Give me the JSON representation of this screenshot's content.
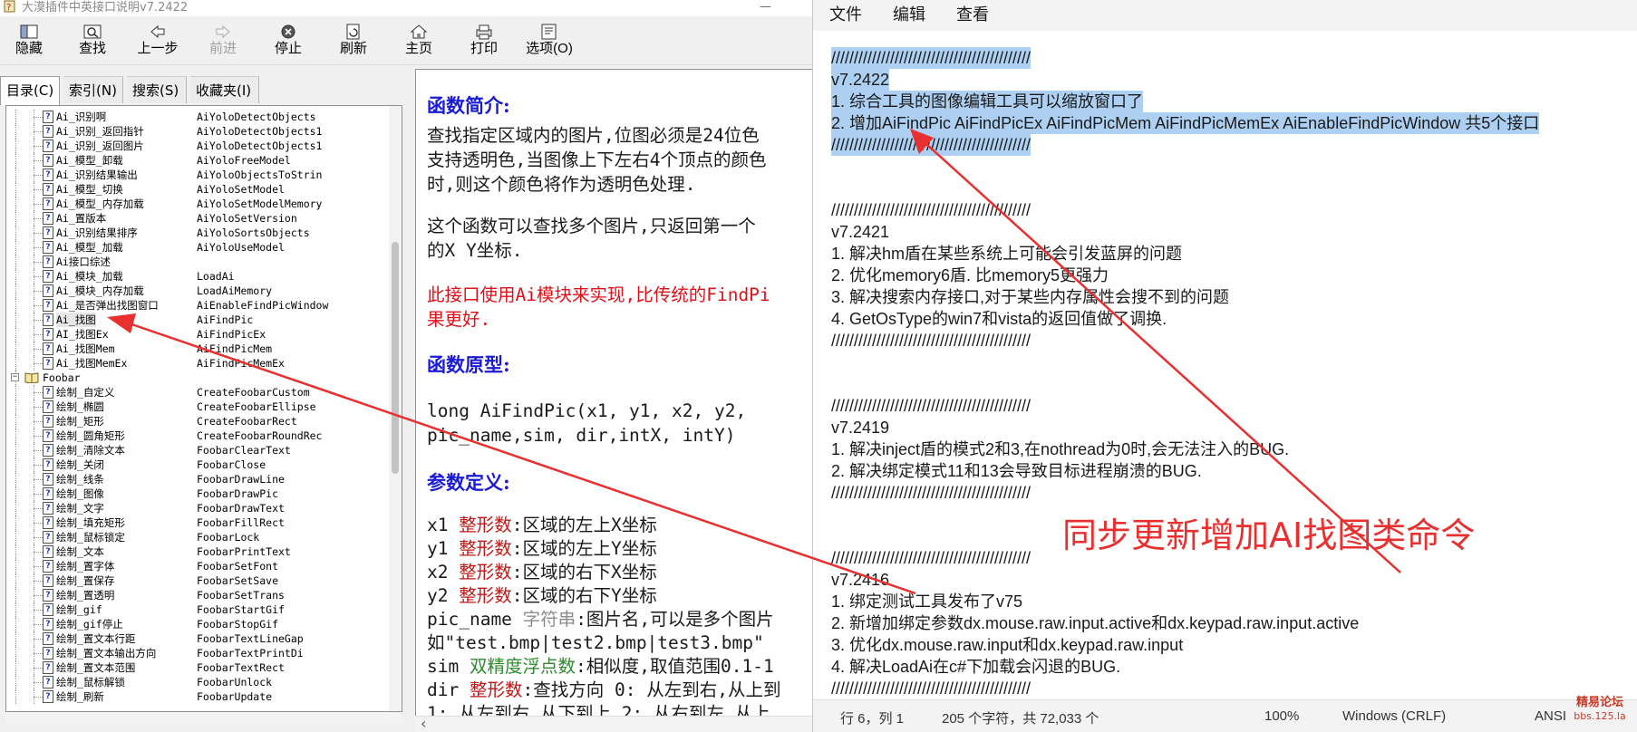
{
  "chm": {
    "title": "大漠插件中英接口说明v7.2422",
    "toolbar": [
      {
        "label": "隐藏",
        "icon": "hide-icon"
      },
      {
        "label": "查找",
        "icon": "find-icon"
      },
      {
        "label": "上一步",
        "icon": "back-arrow-icon"
      },
      {
        "label": "前进",
        "icon": "forward-arrow-icon",
        "disabled": true
      },
      {
        "label": "停止",
        "icon": "stop-icon"
      },
      {
        "label": "刷新",
        "icon": "refresh-icon"
      },
      {
        "label": "主页",
        "icon": "home-icon"
      },
      {
        "label": "打印",
        "icon": "print-icon"
      },
      {
        "label": "选项(O)",
        "icon": "options-icon"
      }
    ],
    "nav_tabs": [
      "目录(C)",
      "索引(N)",
      "搜索(S)",
      "收藏夹(I)"
    ],
    "tree": [
      {
        "name": "Ai_识别啊",
        "api": "AiYoloDetectObjects",
        "indent": 2,
        "icon": "doc"
      },
      {
        "name": "Ai_识别_返回指针",
        "api": "AiYoloDetectObjects1",
        "indent": 2,
        "icon": "doc"
      },
      {
        "name": "Ai_识别_返回图片",
        "api": "AiYoloDetectObjects1",
        "indent": 2,
        "icon": "doc"
      },
      {
        "name": "Ai_模型_卸载",
        "api": "AiYoloFreeModel",
        "indent": 2,
        "icon": "doc"
      },
      {
        "name": "Ai_识别结果输出",
        "api": "AiYoloObjectsToStrin",
        "indent": 2,
        "icon": "doc"
      },
      {
        "name": "Ai_模型_切换",
        "api": "AiYoloSetModel",
        "indent": 2,
        "icon": "doc"
      },
      {
        "name": "Ai_模型_内存加载",
        "api": "AiYoloSetModelMemory",
        "indent": 2,
        "icon": "doc"
      },
      {
        "name": "Ai_置版本",
        "api": "AiYoloSetVersion",
        "indent": 2,
        "icon": "doc"
      },
      {
        "name": "Ai_识别结果排序",
        "api": "AiYoloSortsObjects",
        "indent": 2,
        "icon": "doc"
      },
      {
        "name": "Ai_模型_加载",
        "api": "AiYoloUseModel",
        "indent": 2,
        "icon": "doc"
      },
      {
        "name": "Ai接口综述",
        "api": "",
        "indent": 2,
        "icon": "doc"
      },
      {
        "name": "Ai_模块_加载",
        "api": "LoadAi",
        "indent": 2,
        "icon": "doc"
      },
      {
        "name": "Ai_模块_内存加载",
        "api": "LoadAiMemory",
        "indent": 2,
        "icon": "doc"
      },
      {
        "name": "Ai_是否弹出找图窗口",
        "api": "AiEnableFindPicWindow",
        "indent": 2,
        "icon": "doc"
      },
      {
        "name": "Ai_找图",
        "api": "AiFindPic",
        "indent": 2,
        "icon": "doc",
        "selected": true
      },
      {
        "name": "AI_找图Ex",
        "api": "AiFindPicEx",
        "indent": 2,
        "icon": "doc"
      },
      {
        "name": "Ai_找图Mem",
        "api": "AiFindPicMem",
        "indent": 2,
        "icon": "doc"
      },
      {
        "name": "Ai_找图MemEx",
        "api": "AiFindPicMemEx",
        "indent": 2,
        "icon": "doc"
      },
      {
        "name": "Foobar",
        "api": "",
        "indent": 0,
        "icon": "book"
      },
      {
        "name": "绘制_自定义",
        "api": "CreateFoobarCustom",
        "indent": 2,
        "icon": "doc"
      },
      {
        "name": "绘制_椭圆",
        "api": "CreateFoobarEllipse",
        "indent": 2,
        "icon": "doc"
      },
      {
        "name": "绘制_矩形",
        "api": "CreateFoobarRect",
        "indent": 2,
        "icon": "doc"
      },
      {
        "name": "绘制_圆角矩形",
        "api": "CreateFoobarRoundRec",
        "indent": 2,
        "icon": "doc"
      },
      {
        "name": "绘制_清除文本",
        "api": "FoobarClearText",
        "indent": 2,
        "icon": "doc"
      },
      {
        "name": "绘制_关闭",
        "api": "FoobarClose",
        "indent": 2,
        "icon": "doc"
      },
      {
        "name": "绘制_线条",
        "api": "FoobarDrawLine",
        "indent": 2,
        "icon": "doc"
      },
      {
        "name": "绘制_图像",
        "api": "FoobarDrawPic",
        "indent": 2,
        "icon": "doc"
      },
      {
        "name": "绘制_文字",
        "api": "FoobarDrawText",
        "indent": 2,
        "icon": "doc"
      },
      {
        "name": "绘制_填充矩形",
        "api": "FoobarFillRect",
        "indent": 2,
        "icon": "doc"
      },
      {
        "name": "绘制_鼠标锁定",
        "api": "FoobarLock",
        "indent": 2,
        "icon": "doc"
      },
      {
        "name": "绘制_文本",
        "api": "FoobarPrintText",
        "indent": 2,
        "icon": "doc"
      },
      {
        "name": "绘制_置字体",
        "api": "FoobarSetFont",
        "indent": 2,
        "icon": "doc"
      },
      {
        "name": "绘制_置保存",
        "api": "FoobarSetSave",
        "indent": 2,
        "icon": "doc"
      },
      {
        "name": "绘制_置透明",
        "api": "FoobarSetTrans",
        "indent": 2,
        "icon": "doc"
      },
      {
        "name": "绘制_gif",
        "api": "FoobarStartGif",
        "indent": 2,
        "icon": "doc"
      },
      {
        "name": "绘制_gif停止",
        "api": "FoobarStopGif",
        "indent": 2,
        "icon": "doc"
      },
      {
        "name": "绘制_置文本行距",
        "api": "FoobarTextLineGap",
        "indent": 2,
        "icon": "doc"
      },
      {
        "name": "绘制_置文本输出方向",
        "api": "FoobarTextPrintDi",
        "indent": 2,
        "icon": "doc"
      },
      {
        "name": "绘制_置文本范围",
        "api": "FoobarTextRect",
        "indent": 2,
        "icon": "doc"
      },
      {
        "name": "绘制_鼠标解锁",
        "api": "FoobarUnlock",
        "indent": 2,
        "icon": "doc"
      },
      {
        "name": "绘制_刷新",
        "api": "FoobarUpdate",
        "indent": 2,
        "icon": "doc"
      }
    ],
    "content": {
      "h_intro": "函数简介:",
      "intro_lines": [
        "查找指定区域内的图片,位图必须是24位色",
        "支持透明色,当图像上下左右4个顶点的颜色",
        "时,则这个颜色将作为透明色处理."
      ],
      "multi_lines": [
        "这个函数可以查找多个图片,只返回第一个",
        "的X Y坐标."
      ],
      "red_lines": [
        "此接口使用Ai模块来实现,比传统的FindPi",
        "果更好."
      ],
      "h_proto": "函数原型:",
      "proto_lines": [
        "long AiFindPic(x1, y1, x2, y2,",
        "pic_name,sim, dir,intX, intY)"
      ],
      "h_params": "参数定义:",
      "params": [
        {
          "name": "x1",
          "type": "整形数",
          "desc": ":区域的左上X坐标",
          "tc": "red"
        },
        {
          "name": "y1",
          "type": "整形数",
          "desc": ":区域的左上Y坐标",
          "tc": "red"
        },
        {
          "name": "x2",
          "type": "整形数",
          "desc": ":区域的右下X坐标",
          "tc": "red"
        },
        {
          "name": "y2",
          "type": "整形数",
          "desc": ":区域的右下Y坐标",
          "tc": "red"
        },
        {
          "name": "pic_name",
          "type": "字符串",
          "desc": ":图片名,可以是多个图片",
          "tc": "gray"
        },
        {
          "name": "",
          "type": "",
          "desc": "如\"test.bmp|test2.bmp|test3.bmp\"",
          "tc": ""
        },
        {
          "name": "sim",
          "type": "双精度浮点数",
          "desc": ":相似度,取值范围0.1-1",
          "tc": "green"
        },
        {
          "name": "dir",
          "type": "整形数",
          "desc": ":查找方向 0: 从左到右,从上到",
          "tc": "red"
        },
        {
          "name": "",
          "type": "",
          "desc": "1: 从左到右,从下到上 2: 从右到左,从上",
          "tc": ""
        }
      ]
    }
  },
  "notepad": {
    "menu": [
      "文件",
      "编辑",
      "查看"
    ],
    "lines": [
      {
        "t": "////////////////////////////////////////////",
        "sel": true
      },
      {
        "t": "v7.2422",
        "sel": true
      },
      {
        "t": "1. 综合工具的图像编辑工具可以缩放窗口了",
        "sel": true
      },
      {
        "t": "2. 增加AiFindPic AiFindPicEx AiFindPicMem AiFindPicMemEx AiEnableFindPicWindow 共5个接口",
        "sel": true
      },
      {
        "t": "////////////////////////////////////////////",
        "sel": true
      },
      {
        "t": "",
        "sel": false
      },
      {
        "t": "",
        "sel": false
      },
      {
        "t": "////////////////////////////////////////////",
        "sel": false
      },
      {
        "t": "v7.2421",
        "sel": false
      },
      {
        "t": "1. 解决hm盾在某些系统上可能会引发蓝屏的问题",
        "sel": false
      },
      {
        "t": "2. 优化memory6盾. 比memory5更强力",
        "sel": false
      },
      {
        "t": "3. 解决搜索内存接口,对于某些内存属性会搜不到的问题",
        "sel": false
      },
      {
        "t": "4. GetOsType的win7和vista的返回值做了调换.",
        "sel": false
      },
      {
        "t": "////////////////////////////////////////////",
        "sel": false
      },
      {
        "t": "",
        "sel": false
      },
      {
        "t": "",
        "sel": false
      },
      {
        "t": "////////////////////////////////////////////",
        "sel": false
      },
      {
        "t": "v7.2419",
        "sel": false
      },
      {
        "t": "1. 解决inject盾的模式2和3,在nothread为0时,会无法注入的BUG.",
        "sel": false
      },
      {
        "t": "2. 解决绑定模式11和13会导致目标进程崩溃的BUG.",
        "sel": false
      },
      {
        "t": "////////////////////////////////////////////",
        "sel": false
      },
      {
        "t": "",
        "sel": false
      },
      {
        "t": "",
        "sel": false
      },
      {
        "t": "////////////////////////////////////////////",
        "sel": false
      },
      {
        "t": "v7.2416",
        "sel": false
      },
      {
        "t": "1. 绑定测试工具发布了v75",
        "sel": false
      },
      {
        "t": "2. 新增加绑定参数dx.mouse.raw.input.active和dx.keypad.raw.input.active",
        "sel": false
      },
      {
        "t": "3. 优化dx.mouse.raw.input和dx.keypad.raw.input",
        "sel": false
      },
      {
        "t": "4. 解决LoadAi在c#下加载会闪退的BUG.",
        "sel": false
      },
      {
        "t": "////////////////////////////////////////////",
        "sel": false
      }
    ],
    "status": {
      "position": "行 6，列 1",
      "chars": "205 个字符，共 72,033 个",
      "zoom": "100%",
      "eol": "Windows (CRLF)",
      "encoding": "ANSI"
    }
  },
  "watermark": {
    "line1": "精易论坛",
    "line2": "bbs.125.la"
  },
  "annotation": {
    "text": "同步更新增加AI找图类命令",
    "color": "#e83030"
  }
}
